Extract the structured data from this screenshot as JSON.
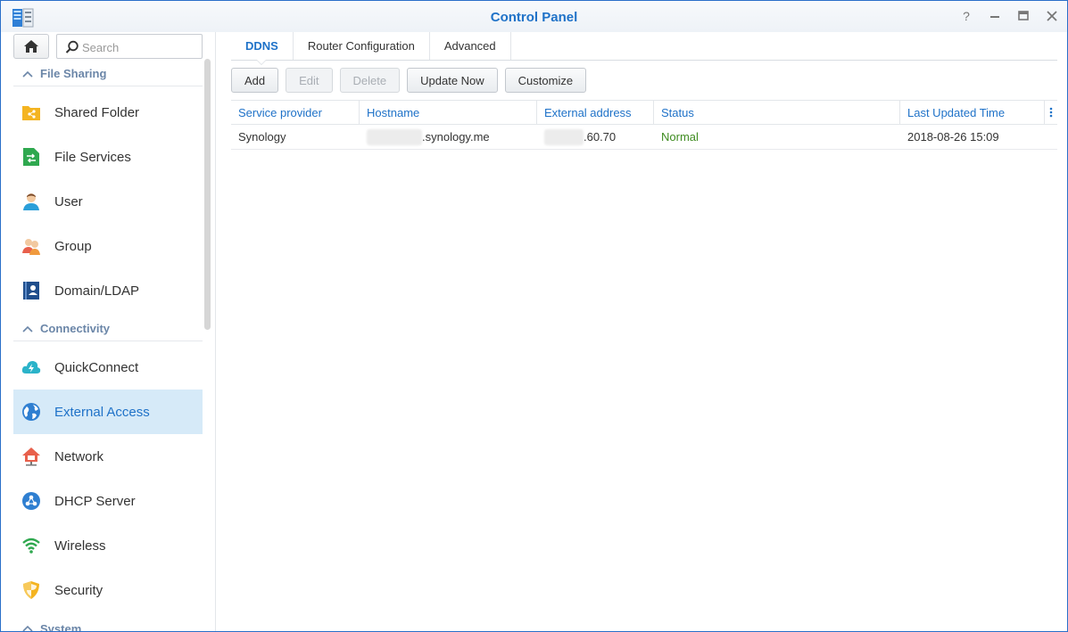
{
  "window": {
    "title": "Control Panel",
    "controls": [
      "help",
      "minimize",
      "maximize",
      "close"
    ]
  },
  "sidebar": {
    "search_placeholder": "Search",
    "sections": [
      {
        "label": "File Sharing",
        "items": [
          {
            "label": "Shared Folder",
            "icon": "shared-folder-icon"
          },
          {
            "label": "File Services",
            "icon": "file-services-icon"
          },
          {
            "label": "User",
            "icon": "user-icon"
          },
          {
            "label": "Group",
            "icon": "group-icon"
          },
          {
            "label": "Domain/LDAP",
            "icon": "domain-ldap-icon"
          }
        ]
      },
      {
        "label": "Connectivity",
        "items": [
          {
            "label": "QuickConnect",
            "icon": "quickconnect-icon"
          },
          {
            "label": "External Access",
            "icon": "external-access-icon",
            "active": true
          },
          {
            "label": "Network",
            "icon": "network-icon"
          },
          {
            "label": "DHCP Server",
            "icon": "dhcp-server-icon"
          },
          {
            "label": "Wireless",
            "icon": "wireless-icon"
          },
          {
            "label": "Security",
            "icon": "security-icon"
          }
        ]
      },
      {
        "label": "System",
        "items": []
      }
    ]
  },
  "main": {
    "tabs": [
      {
        "label": "DDNS",
        "active": true
      },
      {
        "label": "Router Configuration"
      },
      {
        "label": "Advanced"
      }
    ],
    "toolbar": {
      "add": "Add",
      "edit": "Edit",
      "delete": "Delete",
      "update_now": "Update Now",
      "customize": "Customize"
    },
    "table": {
      "columns": [
        "Service provider",
        "Hostname",
        "External address",
        "Status",
        "Last Updated Time"
      ],
      "rows": [
        {
          "service_provider": "Synology",
          "hostname": ".synology.me",
          "external_address": ".60.70",
          "status": "Normal",
          "last_updated": "2018-08-26 15:09"
        }
      ]
    }
  },
  "colors": {
    "accent": "#1f72c8",
    "active_bg": "#d6eaf8",
    "status_ok": "#3f8c21",
    "section_header": "#6b86a8"
  }
}
